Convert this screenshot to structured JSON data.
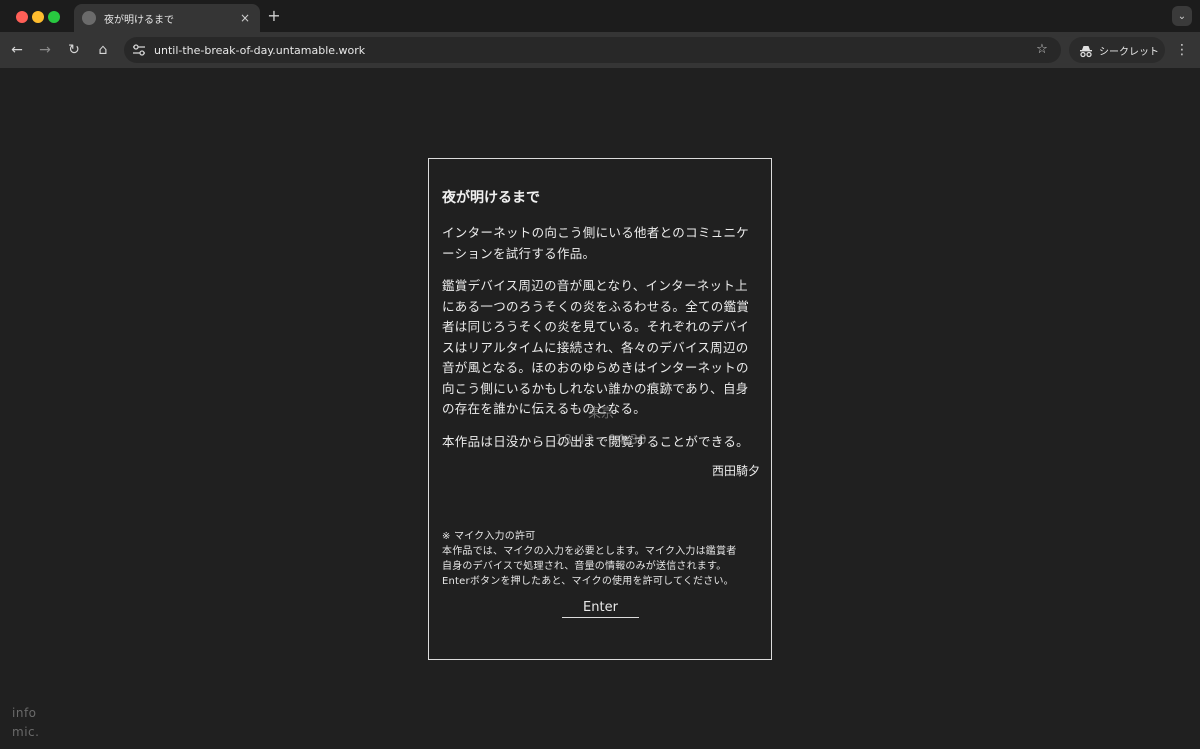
{
  "browser": {
    "tab": {
      "title": "夜が明けるまで",
      "close_glyph": "×"
    },
    "new_tab_glyph": "+",
    "tab_search_glyph": "⌄",
    "nav": {
      "back_glyph": "←",
      "forward_glyph": "→",
      "reload_glyph": "↻",
      "home_glyph": "⌂"
    },
    "address_bar": {
      "url": "until-the-break-of-day.untamable.work"
    },
    "bookmark_glyph": "☆",
    "incognito_label": "シークレット",
    "menu_glyph": "⋮"
  },
  "intro": {
    "title": "夜が明けるまで",
    "paragraph_1": "インターネットの向こう側にいる他者とのコミュニケーションを試行する作品。",
    "paragraph_2": "鑑賞デバイス周辺の音が風となり、インターネット上にある一つのろうそくの炎をふるわせる。全ての鑑賞者は同じろうそくの炎を見ている。それぞれのデバイスはリアルタイムに接続され、各々のデバイス周辺の音が風となる。ほのおのゆらめきはインターネットの向こう側にいるかもしれない誰かの痕跡であり、自身の存在を誰かに伝えるものとなる。",
    "paragraph_3": "本作品は日没から日の出まで閲覧することができる。",
    "author": "西田騎夕",
    "mic_note": {
      "heading": "※ マイク入力の許可",
      "line_1": "本作品では、マイクの入力を必要とします。マイク入力は鑑賞者",
      "line_2": "自身のデバイスで処理され、音量の情報のみが送信されます。",
      "line_3": "Enterボタンを押したあと、マイクの使用を許可してください。"
    },
    "enter_label": "Enter"
  },
  "background": {
    "city": "東京",
    "time_range": "18:43 - 04:30"
  },
  "corner_links": {
    "info": "info",
    "mic": "mic."
  },
  "colors": {
    "page_bg": "#202020",
    "toolbar_bg": "#353535",
    "tabstrip_bg": "#1c1c1c",
    "panel_border": "#dcdcdc",
    "traffic_red": "#ff5f57",
    "traffic_yellow": "#febc2e",
    "traffic_green": "#28c840"
  },
  "icons": [
    "globe-favicon-icon",
    "site-info-icon",
    "bookmark-star-icon",
    "incognito-icon",
    "kebab-menu-icon"
  ]
}
